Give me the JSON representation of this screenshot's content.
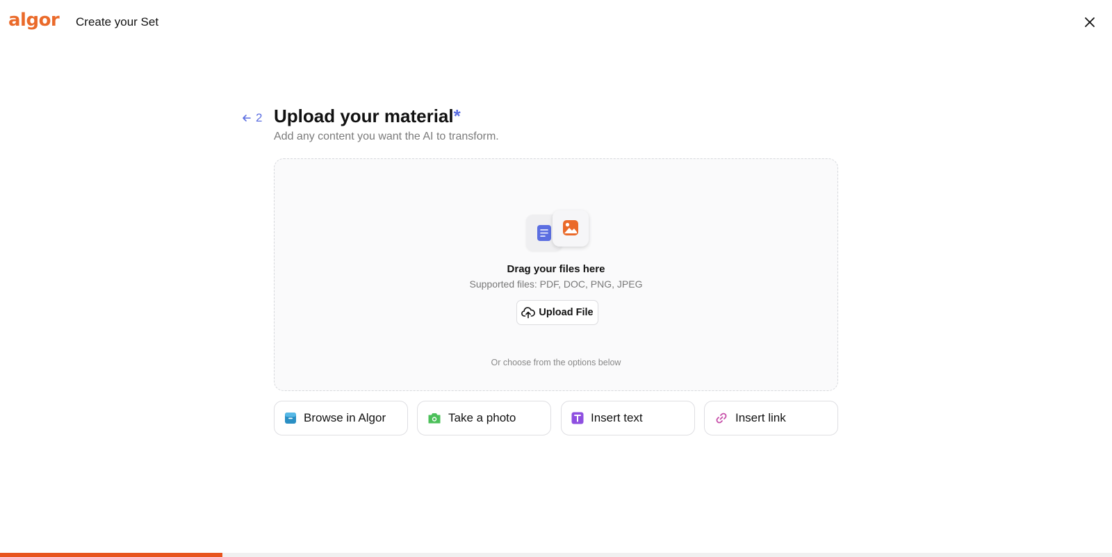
{
  "header": {
    "logo_text": "algor",
    "title": "Create your Set",
    "close_icon": "close-icon"
  },
  "step": {
    "number": "2",
    "back_icon": "arrow-left-icon",
    "title": "Upload your material",
    "required_marker": "*",
    "subtitle": "Add any content you want the AI to transform."
  },
  "dropzone": {
    "icons": [
      "document-icon",
      "image-icon"
    ],
    "title": "Drag your files here",
    "supported": "Supported files: PDF, DOC, PNG, JPEG",
    "upload_label": "Upload File",
    "upload_icon": "cloud-upload-icon",
    "alt_text": "Or choose from the options below"
  },
  "options": [
    {
      "label": "Browse in Algor",
      "icon": "folder-icon",
      "color": "#2a8fc4"
    },
    {
      "label": "Take a photo",
      "icon": "camera-icon",
      "color": "#4cc05a"
    },
    {
      "label": "Insert text",
      "icon": "text-icon",
      "color": "#8e4fe0"
    },
    {
      "label": "Insert link",
      "icon": "link-icon",
      "color": "#c64ca8"
    }
  ],
  "progress": {
    "fraction": 0.2
  },
  "colors": {
    "brand": "#ea6a2a",
    "accent": "#5b6ee1",
    "progress": "#e8541d",
    "doc_icon": "#5b6ee1",
    "image_icon": "#ea6a2a"
  }
}
